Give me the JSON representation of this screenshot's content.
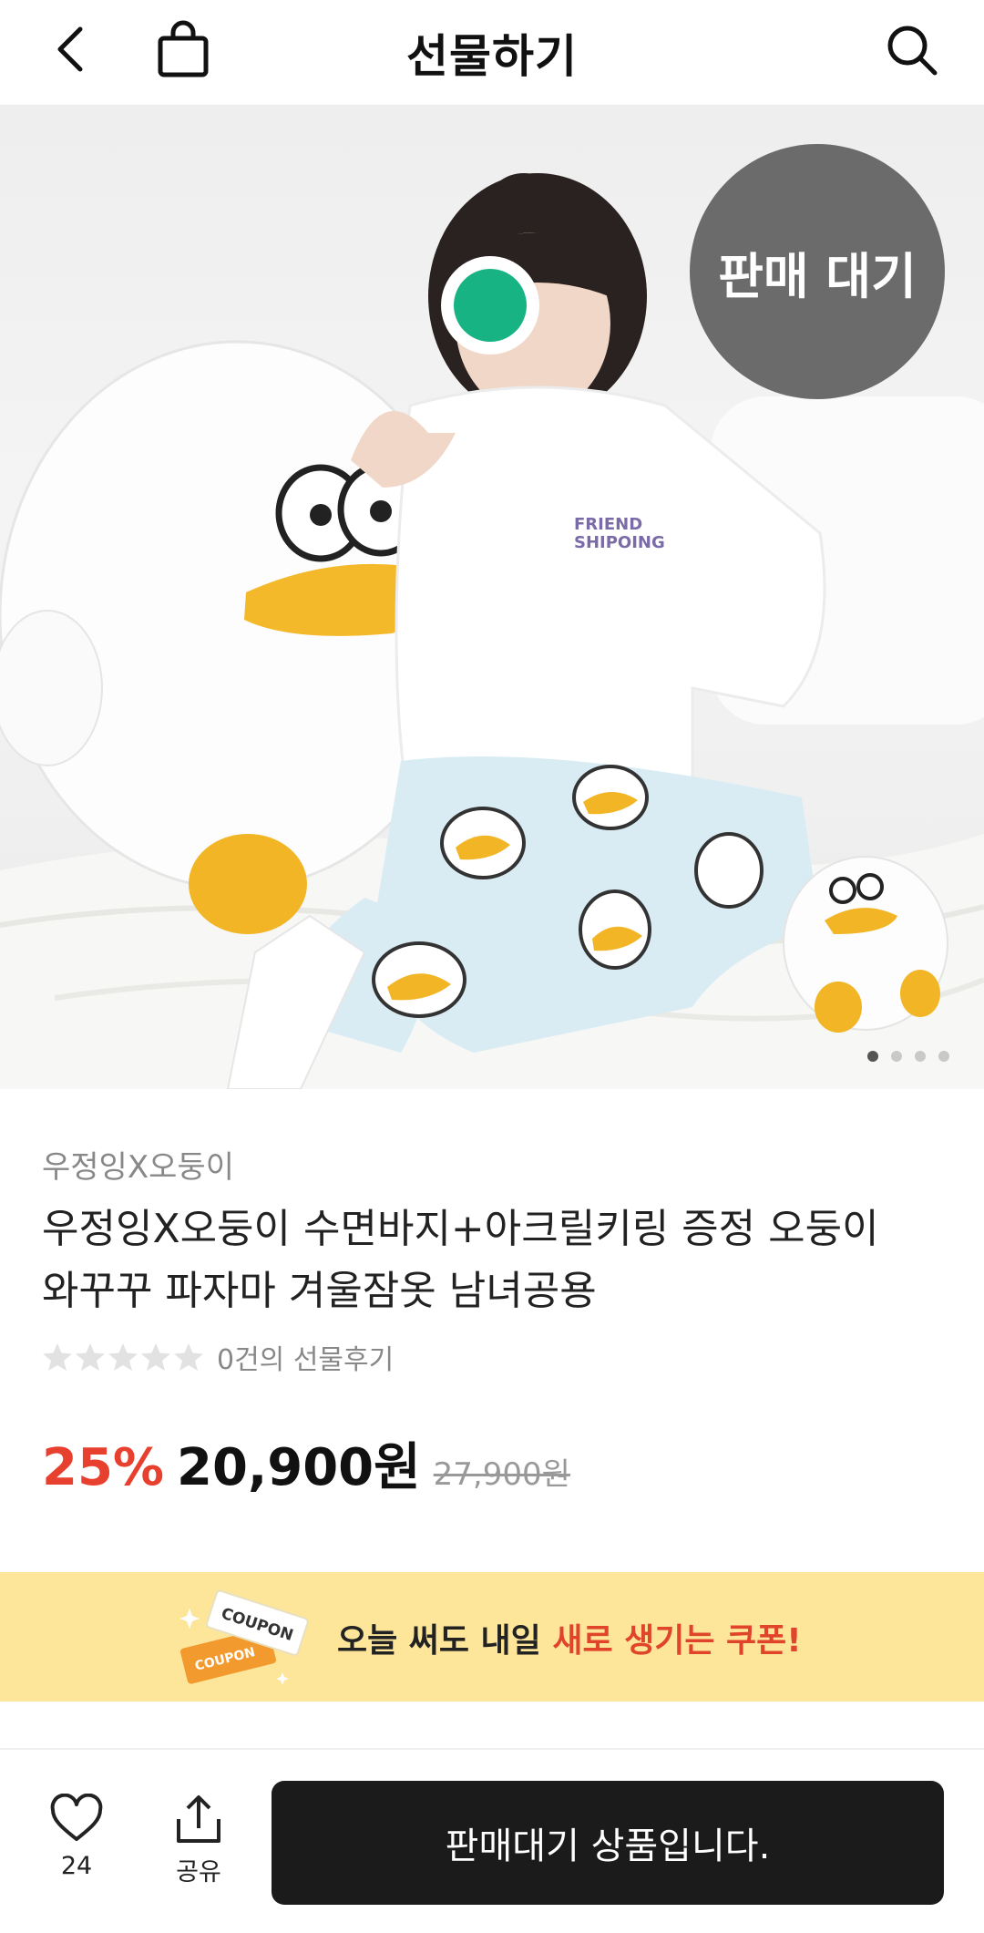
{
  "header": {
    "title": "선물하기",
    "back_icon": "chevron-left-icon",
    "bag_icon": "shopping-bag-icon",
    "search_icon": "search-icon"
  },
  "hero": {
    "badge": "판매 대기",
    "carousel_total": 4,
    "carousel_active": 1,
    "shirt_print": [
      "FRIEND",
      "SHIPOING"
    ]
  },
  "product": {
    "brand": "우정잉X오둥이",
    "name_line1": "우정잉X오둥이 수면바지+아크릴키링 증정 오둥이",
    "name_line2": "와꾸꾸 파자마 겨울잠옷 남녀공용",
    "rating_stars": 0,
    "review_text": "0건의 선물후기",
    "discount": "25%",
    "sale_price": "20,900원",
    "original_price": "27,900원"
  },
  "coupon": {
    "text_main": "오늘 써도 내일 ",
    "text_accent": "새로 생기는 쿠폰!",
    "ticket_label": "COUPON",
    "accent_color": "#e0452b",
    "background": "#fde59a"
  },
  "bottom_bar": {
    "like_count": "24",
    "share_label": "공유",
    "cta_label": "판매대기 상품입니다."
  }
}
